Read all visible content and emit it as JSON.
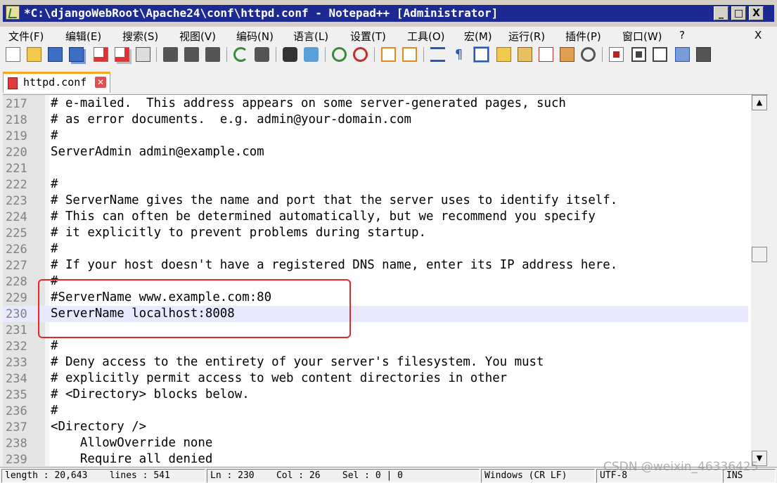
{
  "window": {
    "title": "*C:\\djangoWebRoot\\Apache24\\conf\\httpd.conf - Notepad++ [Administrator]",
    "minimize_glyph": "_",
    "maximize_glyph": "□",
    "close_glyph": "X"
  },
  "menu": {
    "items": [
      "文件(F)",
      "编辑(E)",
      "搜索(S)",
      "视图(V)",
      "编码(N)",
      "语言(L)",
      "设置(T)",
      "工具(O)",
      "宏(M)",
      "运行(R)",
      "插件(P)",
      "窗口(W)",
      "?"
    ],
    "close_doc": "X"
  },
  "toolbar": {
    "icons": [
      "new-file-icon",
      "open-file-icon",
      "save-icon",
      "save-all-icon",
      "close-icon",
      "close-all-icon",
      "print-icon",
      "cut-icon",
      "copy-icon",
      "paste-icon",
      "undo-icon",
      "redo-icon",
      "find-icon",
      "replace-icon",
      "zoom-in-icon",
      "zoom-out-icon",
      "sync-vertical-icon",
      "sync-horizontal-icon",
      "word-wrap-icon",
      "show-all-chars-icon",
      "indent-guide-icon",
      "user-lang-icon",
      "doc-map-icon",
      "function-list-icon",
      "folder-workspace-icon",
      "monitor-icon",
      "record-macro-icon",
      "stop-record-icon",
      "playback-icon",
      "run-macro-multiple-icon",
      "save-macro-icon"
    ]
  },
  "tab": {
    "label": "httpd.conf",
    "close_glyph": "✕"
  },
  "editor": {
    "lines": [
      {
        "n": "217",
        "text": "# e-mailed.  This address appears on some server-generated pages, such"
      },
      {
        "n": "218",
        "text": "# as error documents.  e.g. admin@your-domain.com"
      },
      {
        "n": "219",
        "text": "#"
      },
      {
        "n": "220",
        "text": "ServerAdmin admin@example.com"
      },
      {
        "n": "221",
        "text": ""
      },
      {
        "n": "222",
        "text": "#"
      },
      {
        "n": "223",
        "text": "# ServerName gives the name and port that the server uses to identify itself."
      },
      {
        "n": "224",
        "text": "# This can often be determined automatically, but we recommend you specify"
      },
      {
        "n": "225",
        "text": "# it explicitly to prevent problems during startup."
      },
      {
        "n": "226",
        "text": "#"
      },
      {
        "n": "227",
        "text": "# If your host doesn't have a registered DNS name, enter its IP address here."
      },
      {
        "n": "228",
        "text": "#"
      },
      {
        "n": "229",
        "text": "#ServerName www.example.com:80"
      },
      {
        "n": "230",
        "text": "ServerName localhost:8008"
      },
      {
        "n": "231",
        "text": ""
      },
      {
        "n": "232",
        "text": "#"
      },
      {
        "n": "233",
        "text": "# Deny access to the entirety of your server's filesystem. You must"
      },
      {
        "n": "234",
        "text": "# explicitly permit access to web content directories in other"
      },
      {
        "n": "235",
        "text": "# <Directory> blocks below."
      },
      {
        "n": "236",
        "text": "#"
      },
      {
        "n": "237",
        "text": "<Directory />"
      },
      {
        "n": "238",
        "text": "    AllowOverride none"
      },
      {
        "n": "239",
        "text": "    Require all denied"
      }
    ],
    "current_line": "230",
    "scroll_up_glyph": "▲",
    "scroll_down_glyph": "▼"
  },
  "status": {
    "length": "length : 20,643",
    "lines": "lines : 541",
    "ln": "Ln : 230",
    "col": "Col : 26",
    "sel": "Sel : 0 | 0",
    "eol": "Windows (CR LF)",
    "encoding": "UTF-8",
    "mode": "INS"
  },
  "watermark": "CSDN @weixin_46336425",
  "colors": {
    "title_bar": "#1e2a93",
    "current_line": "#e8e8ff",
    "highlight_box": "#e32626",
    "tab_accent": "#f5a623"
  }
}
